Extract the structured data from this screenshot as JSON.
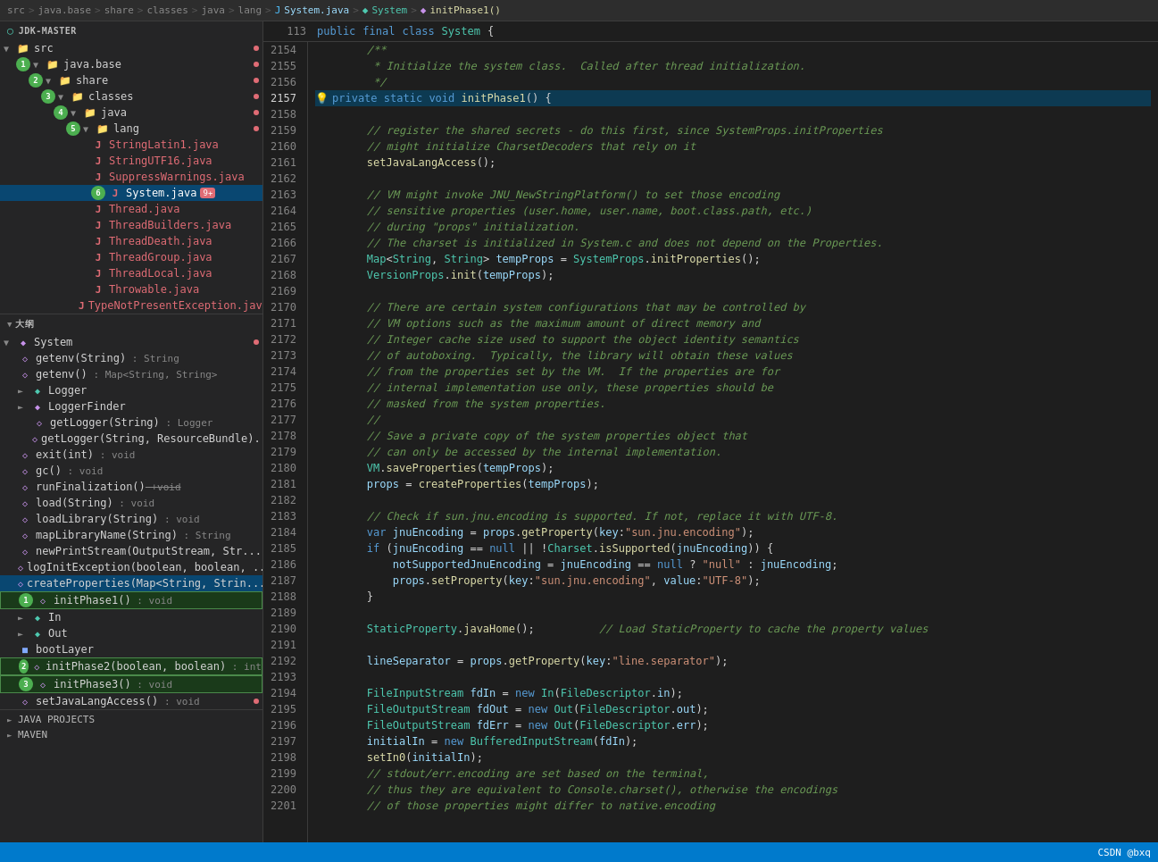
{
  "breadcrumb": {
    "items": [
      {
        "label": "src",
        "type": "plain"
      },
      {
        "label": ">",
        "type": "sep"
      },
      {
        "label": "java.base",
        "type": "plain"
      },
      {
        "label": ">",
        "type": "sep"
      },
      {
        "label": "share",
        "type": "plain"
      },
      {
        "label": ">",
        "type": "sep"
      },
      {
        "label": "classes",
        "type": "plain"
      },
      {
        "label": ">",
        "type": "sep"
      },
      {
        "label": "java",
        "type": "plain"
      },
      {
        "label": ">",
        "type": "sep"
      },
      {
        "label": "lang",
        "type": "plain"
      },
      {
        "label": ">",
        "type": "sep"
      },
      {
        "label": "System.java",
        "type": "file"
      },
      {
        "label": ">",
        "type": "sep"
      },
      {
        "label": "System",
        "type": "class"
      },
      {
        "label": ">",
        "type": "sep"
      },
      {
        "label": "initPhase1()",
        "type": "method"
      }
    ]
  },
  "sidebar": {
    "project_title": "JDK-MASTER",
    "file_tree": [
      {
        "id": "src",
        "label": "src",
        "level": 0,
        "type": "folder",
        "expanded": true,
        "badge": null
      },
      {
        "id": "java.base",
        "label": "java.base",
        "level": 1,
        "type": "folder",
        "expanded": true,
        "badge": "1"
      },
      {
        "id": "share",
        "label": "share",
        "level": 2,
        "type": "folder",
        "expanded": true,
        "badge": "2"
      },
      {
        "id": "classes",
        "label": "classes",
        "level": 3,
        "type": "folder",
        "expanded": true,
        "badge": "3"
      },
      {
        "id": "java",
        "label": "java",
        "level": 4,
        "type": "folder",
        "expanded": true,
        "badge": "4"
      },
      {
        "id": "lang",
        "label": "lang",
        "level": 5,
        "type": "folder",
        "expanded": true,
        "badge": "5"
      },
      {
        "id": "StringLatin1.java",
        "label": "StringLatin1.java",
        "level": 6,
        "type": "java",
        "badge": null
      },
      {
        "id": "StringUTF16.java",
        "label": "StringUTF16.java",
        "level": 6,
        "type": "java",
        "badge": null
      },
      {
        "id": "SuppressWarnings.java",
        "label": "SuppressWarnings.java",
        "level": 6,
        "type": "java",
        "badge": null
      },
      {
        "id": "System.java",
        "label": "System.java",
        "level": 6,
        "type": "java",
        "selected": true,
        "badge": "6",
        "badge_count": "9+"
      },
      {
        "id": "Thread.java",
        "label": "Thread.java",
        "level": 6,
        "type": "java",
        "badge": null
      },
      {
        "id": "ThreadBuilders.java",
        "label": "ThreadBuilders.java",
        "level": 6,
        "type": "java",
        "badge": null
      },
      {
        "id": "ThreadDeath.java",
        "label": "ThreadDeath.java",
        "level": 6,
        "type": "java",
        "badge": null
      },
      {
        "id": "ThreadGroup.java",
        "label": "ThreadGroup.java",
        "level": 6,
        "type": "java",
        "badge": null
      },
      {
        "id": "ThreadLocal.java",
        "label": "ThreadLocal.java",
        "level": 6,
        "type": "java",
        "badge": null
      },
      {
        "id": "Throwable.java",
        "label": "Throwable.java",
        "level": 6,
        "type": "java",
        "badge": null
      },
      {
        "id": "TypeNotPresentException.java",
        "label": "TypeNotPresentException.java",
        "level": 6,
        "type": "java",
        "badge": null
      }
    ],
    "line_number": 113,
    "line_content": "public final class System {"
  },
  "structure": {
    "title": "大纲",
    "class_name": "System",
    "items": [
      {
        "id": "getenv_str",
        "label": "getenv(String)",
        "type_info": ": String",
        "level": 1,
        "type": "method",
        "badge": null
      },
      {
        "id": "getenv_map",
        "label": "getenv()",
        "type_info": ": Map<String, String>",
        "level": 1,
        "type": "method",
        "badge": null
      },
      {
        "id": "Logger_field",
        "label": "Logger",
        "type_info": "",
        "level": 1,
        "type": "interface",
        "badge": null
      },
      {
        "id": "LoggerFinder",
        "label": "LoggerFinder",
        "type_info": "",
        "level": 1,
        "type": "class",
        "badge": null
      },
      {
        "id": "getLogger_str",
        "label": "getLogger(String)",
        "type_info": ": Logger",
        "level": 2,
        "type": "method",
        "badge": null
      },
      {
        "id": "getLogger_str_rb",
        "label": "getLogger(String, ResourceBundle)...",
        "type_info": "",
        "level": 2,
        "type": "method",
        "badge": null
      },
      {
        "id": "exit",
        "label": "exit(int)",
        "type_info": ": void",
        "level": 1,
        "type": "method",
        "badge": null
      },
      {
        "id": "gc",
        "label": "gc()",
        "type_info": ": void",
        "level": 1,
        "type": "method",
        "badge": null
      },
      {
        "id": "runFinalization",
        "label": "runFinalization()",
        "type_info": "+void",
        "level": 1,
        "type": "method",
        "badge": null
      },
      {
        "id": "load",
        "label": "load(String)",
        "type_info": ": void",
        "level": 1,
        "type": "method",
        "badge": null
      },
      {
        "id": "loadLibrary",
        "label": "loadLibrary(String)",
        "type_info": ": void",
        "level": 1,
        "type": "method",
        "badge": null
      },
      {
        "id": "mapLibraryName",
        "label": "mapLibraryName(String)",
        "type_info": ": String",
        "level": 1,
        "type": "method",
        "badge": null
      },
      {
        "id": "newPrintStream",
        "label": "newPrintStream(OutputStream, Str...",
        "type_info": "",
        "level": 1,
        "type": "method",
        "badge": null
      },
      {
        "id": "logInitException",
        "label": "logInitException(boolean, boolean, ...",
        "type_info": "",
        "level": 1,
        "type": "method",
        "badge": null
      },
      {
        "id": "createProperties",
        "label": "createProperties(Map<String, Strin...",
        "type_info": "",
        "level": 1,
        "type": "method",
        "selected": true,
        "badge": null
      },
      {
        "id": "initPhase1",
        "label": "initPhase1()",
        "type_info": ": void",
        "level": 1,
        "type": "method",
        "badge": "1",
        "highlighted": true
      },
      {
        "id": "In",
        "label": "In",
        "type_info": "",
        "level": 1,
        "type": "class",
        "badge": null
      },
      {
        "id": "Out",
        "label": "Out",
        "type_info": "",
        "level": 1,
        "type": "class",
        "badge": null
      },
      {
        "id": "bootLayer",
        "label": "bootLayer",
        "type_info": "",
        "level": 1,
        "type": "field",
        "badge": null
      },
      {
        "id": "initPhase2",
        "label": "initPhase2(boolean, boolean)",
        "type_info": ": int",
        "level": 1,
        "type": "method",
        "badge": "2",
        "highlighted": true
      },
      {
        "id": "initPhase3",
        "label": "initPhase3()",
        "type_info": ": void",
        "level": 1,
        "type": "method",
        "badge": "3",
        "highlighted": true
      },
      {
        "id": "setJavaLangAccess",
        "label": "setJavaLangAccess()",
        "type_info": ": void",
        "level": 1,
        "type": "method",
        "dot_red": true
      }
    ]
  },
  "bottom_sections": [
    {
      "label": "JAVA PROJECTS"
    },
    {
      "label": "MAVEN"
    }
  ],
  "code": {
    "lines": [
      {
        "num": 2154,
        "content": "/**",
        "type": "comment"
      },
      {
        "num": 2155,
        "content": " * Initialize the system class.  Called after thread initialization.",
        "type": "comment"
      },
      {
        "num": 2156,
        "content": " */",
        "type": "comment"
      },
      {
        "num": 2157,
        "content": "private static void initPhase1() {",
        "type": "code",
        "highlighted": true,
        "bulb": true
      },
      {
        "num": 2158,
        "content": "",
        "type": "empty"
      },
      {
        "num": 2159,
        "content": "    // register the shared secrets - do this first, since SystemProps.initProperties",
        "type": "comment"
      },
      {
        "num": 2160,
        "content": "    // might initialize CharsetDecoders that rely on it",
        "type": "comment"
      },
      {
        "num": 2161,
        "content": "    setJavaLangAccess();",
        "type": "code"
      },
      {
        "num": 2162,
        "content": "",
        "type": "empty"
      },
      {
        "num": 2163,
        "content": "    // VM might invoke JNU_NewStringPlatform() to set those encoding",
        "type": "comment"
      },
      {
        "num": 2164,
        "content": "    // sensitive properties (user.home, user.name, boot.class.path, etc.)",
        "type": "comment"
      },
      {
        "num": 2165,
        "content": "    // during \"props\" initialization.",
        "type": "comment"
      },
      {
        "num": 2166,
        "content": "    // The charset is initialized in System.c and does not depend on the Properties.",
        "type": "comment"
      },
      {
        "num": 2167,
        "content": "    Map<String, String> tempProps = SystemProps.initProperties();",
        "type": "code"
      },
      {
        "num": 2168,
        "content": "    VersionProps.init(tempProps);",
        "type": "code"
      },
      {
        "num": 2169,
        "content": "",
        "type": "empty"
      },
      {
        "num": 2170,
        "content": "    // There are certain system configurations that may be controlled by",
        "type": "comment"
      },
      {
        "num": 2171,
        "content": "    // VM options such as the maximum amount of direct memory and",
        "type": "comment"
      },
      {
        "num": 2172,
        "content": "    // Integer cache size used to support the object identity semantics",
        "type": "comment"
      },
      {
        "num": 2173,
        "content": "    // of autoboxing.  Typically, the library will obtain these values",
        "type": "comment"
      },
      {
        "num": 2174,
        "content": "    // from the properties set by the VM.  If the properties are for",
        "type": "comment"
      },
      {
        "num": 2175,
        "content": "    // internal implementation use only, these properties should be",
        "type": "comment"
      },
      {
        "num": 2176,
        "content": "    // masked from the system properties.",
        "type": "comment"
      },
      {
        "num": 2177,
        "content": "    //",
        "type": "comment"
      },
      {
        "num": 2178,
        "content": "    // Save a private copy of the system properties object that",
        "type": "comment"
      },
      {
        "num": 2179,
        "content": "    // can only be accessed by the internal implementation.",
        "type": "comment"
      },
      {
        "num": 2180,
        "content": "    VM.saveProperties(tempProps);",
        "type": "code"
      },
      {
        "num": 2181,
        "content": "    props = createProperties(tempProps);",
        "type": "code"
      },
      {
        "num": 2182,
        "content": "",
        "type": "empty"
      },
      {
        "num": 2183,
        "content": "    // Check if sun.jnu.encoding is supported. If not, replace it with UTF-8.",
        "type": "comment"
      },
      {
        "num": 2184,
        "content": "    var jnuEncoding = props.getProperty(key:\"sun.jnu.encoding\");",
        "type": "code"
      },
      {
        "num": 2185,
        "content": "    if (jnuEncoding == null || !Charset.isSupported(jnuEncoding)) {",
        "type": "code"
      },
      {
        "num": 2186,
        "content": "        notSupportedJnuEncoding = jnuEncoding == null ? \"null\" : jnuEncoding;",
        "type": "code"
      },
      {
        "num": 2187,
        "content": "        props.setProperty(key:\"sun.jnu.encoding\", value:\"UTF-8\");",
        "type": "code"
      },
      {
        "num": 2188,
        "content": "    }",
        "type": "code"
      },
      {
        "num": 2189,
        "content": "",
        "type": "empty"
      },
      {
        "num": 2190,
        "content": "    StaticProperty.javaHome();        // Load StaticProperty to cache the property values",
        "type": "code"
      },
      {
        "num": 2191,
        "content": "",
        "type": "empty"
      },
      {
        "num": 2192,
        "content": "    lineSeparator = props.getProperty(key:\"line.separator\");",
        "type": "code"
      },
      {
        "num": 2193,
        "content": "",
        "type": "empty"
      },
      {
        "num": 2194,
        "content": "    FileInputStream fdIn = new In(FileDescriptor.in);",
        "type": "code"
      },
      {
        "num": 2195,
        "content": "    FileOutputStream fdOut = new Out(FileDescriptor.out);",
        "type": "code"
      },
      {
        "num": 2196,
        "content": "    FileOutputStream fdErr = new Out(FileDescriptor.err);",
        "type": "code"
      },
      {
        "num": 2197,
        "content": "    initialIn = new BufferedInputStream(fdIn);",
        "type": "code"
      },
      {
        "num": 2198,
        "content": "    setIn0(initialIn);",
        "type": "code"
      },
      {
        "num": 2199,
        "content": "    // stdout/err.encoding are set based on the terminal,",
        "type": "comment"
      },
      {
        "num": 2200,
        "content": "    // thus they are equivalent to Console.charset(), otherwise the encodings",
        "type": "comment"
      },
      {
        "num": 2201,
        "content": "    // of those properties might differ to native.encoding",
        "type": "comment"
      }
    ]
  },
  "status_bar": {
    "author": "CSDN @bxq"
  }
}
